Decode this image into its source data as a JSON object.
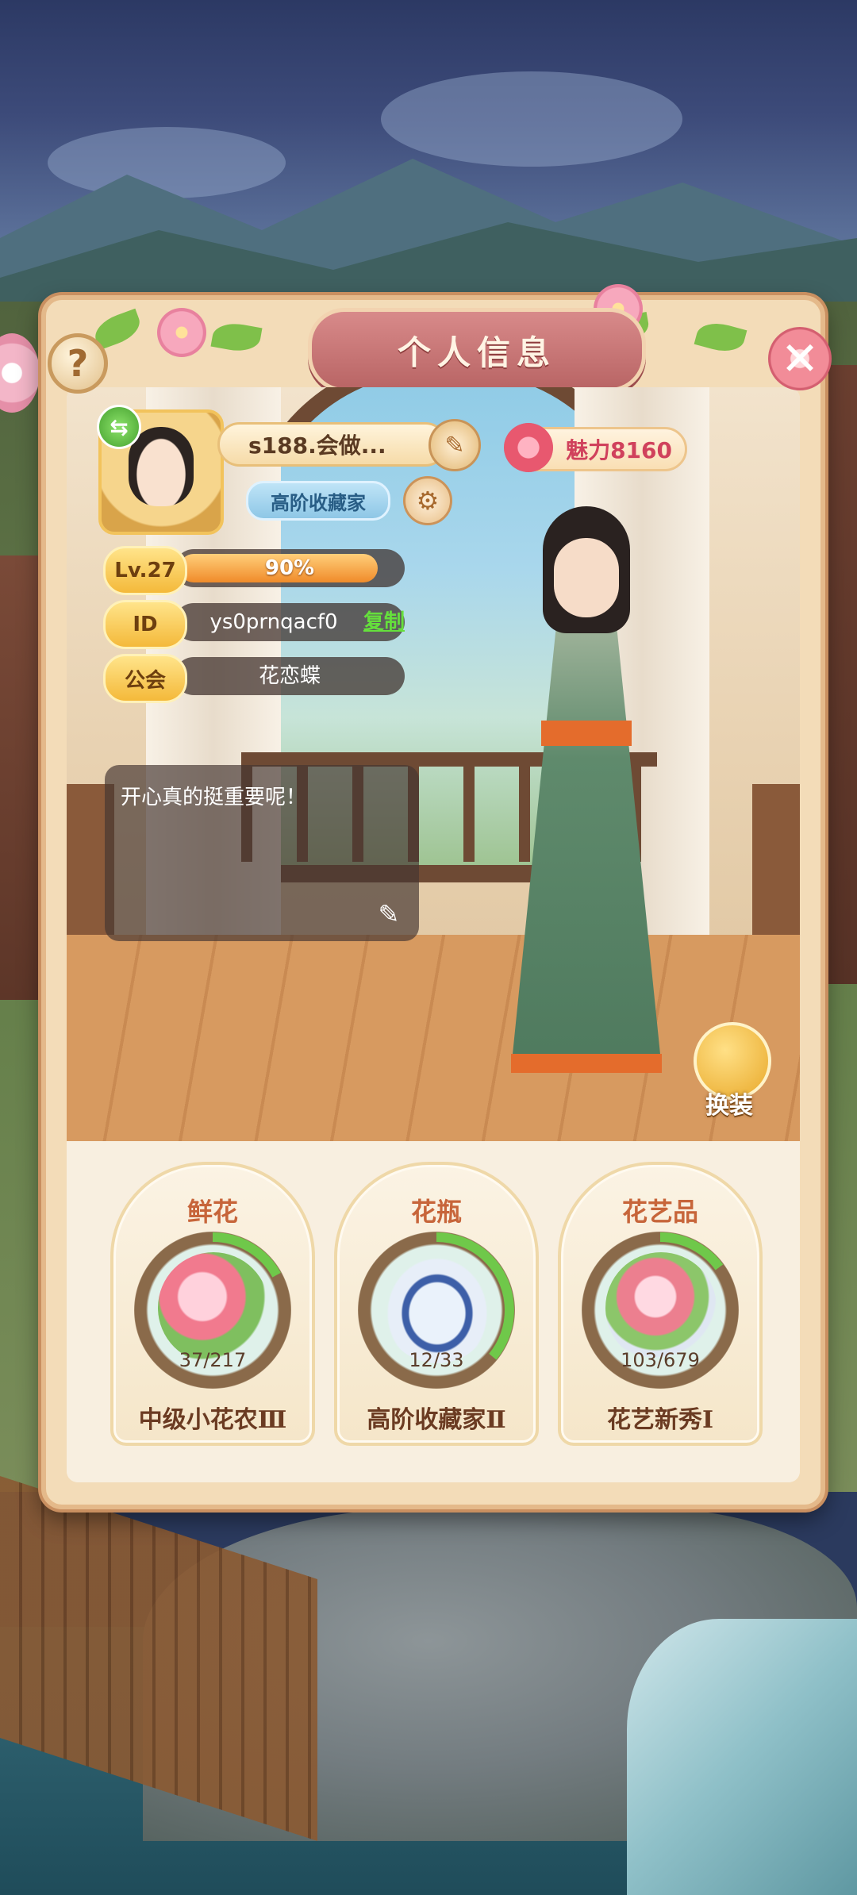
{
  "panel": {
    "title": "个人信息",
    "help_icon": "?",
    "close_icon": "✕"
  },
  "profile": {
    "name": "s188.会做...",
    "title_badge": "高阶收藏家",
    "charm_label": "魅力8160",
    "level_tag": "Lv.27",
    "xp_percent_text": "90%",
    "xp_fraction": 0.9,
    "id_tag": "ID",
    "id_value": "ys0prnqacf0",
    "copy_label": "复制",
    "guild_tag": "公会",
    "guild_name": "花恋蝶",
    "signature": "开心真的挺重要呢！",
    "change_outfit_label": "换装"
  },
  "collections": [
    {
      "title": "鲜花",
      "count": "37/217",
      "progress": 0.17,
      "rank": "中级小花农Ⅲ",
      "icon": "bouquet-icon"
    },
    {
      "title": "花瓶",
      "count": "12/33",
      "progress": 0.36,
      "rank": "高阶收藏家Ⅱ",
      "icon": "vase-icon"
    },
    {
      "title": "花艺品",
      "count": "103/679",
      "progress": 0.15,
      "rank": "花艺新秀Ⅰ",
      "icon": "arrangement-icon"
    }
  ],
  "colors": {
    "accent": "#c7653a",
    "copy_link": "#65e03c",
    "charm": "#d0415c",
    "progress_green": "#6fc84a"
  }
}
